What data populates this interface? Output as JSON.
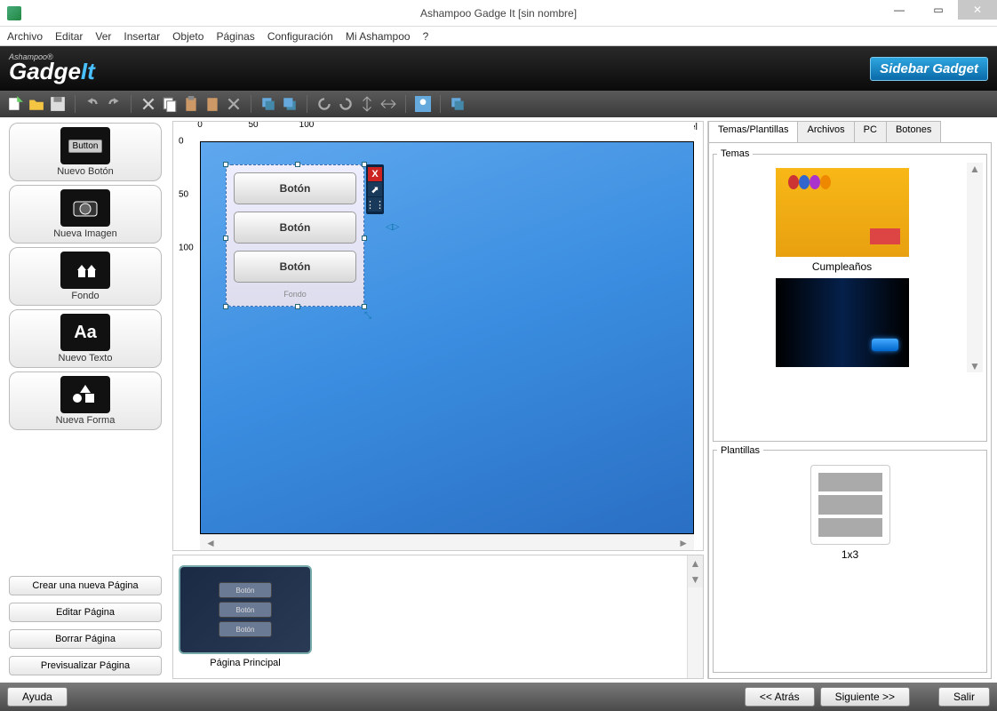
{
  "window": {
    "title": "Ashampoo Gadge It [sin nombre]"
  },
  "menu": [
    "Archivo",
    "Editar",
    "Ver",
    "Insertar",
    "Objeto",
    "Páginas",
    "Configuración",
    "Mi Ashampoo",
    "?"
  ],
  "brand": {
    "small": "Ashampoo®",
    "name": "Gadge",
    "suffix": "It",
    "badge": "Sidebar Gadget"
  },
  "tools": [
    {
      "label": "Nuevo Botón",
      "icon": "Button"
    },
    {
      "label": "Nueva Imagen",
      "icon": "cam"
    },
    {
      "label": "Fondo",
      "icon": "house"
    },
    {
      "label": "Nuevo Texto",
      "icon": "Aa"
    },
    {
      "label": "Nueva Forma",
      "icon": "shapes"
    }
  ],
  "page_buttons": [
    "Crear una nueva Página",
    "Editar Página",
    "Borrar Página",
    "Previsualizar Página"
  ],
  "canvas": {
    "unit": "Pixel",
    "ruler_marks": [
      "0",
      "50",
      "100"
    ],
    "buttons": [
      "Botón",
      "Botón",
      "Botón"
    ],
    "fondo_label": "Fondo"
  },
  "page_thumb": {
    "label": "Página Principal",
    "mini": [
      "Botón",
      "Botón",
      "Botón"
    ]
  },
  "right": {
    "tabs": [
      "Temas/Plantillas",
      "Archivos",
      "PC",
      "Botones"
    ],
    "temas_label": "Temas",
    "plantillas_label": "Plantillas",
    "theme1": "Cumpleaños",
    "template1": "1x3"
  },
  "footer": {
    "help": "Ayuda",
    "back": "<<  Atrás",
    "next": "Siguiente  >>",
    "exit": "Salir"
  }
}
